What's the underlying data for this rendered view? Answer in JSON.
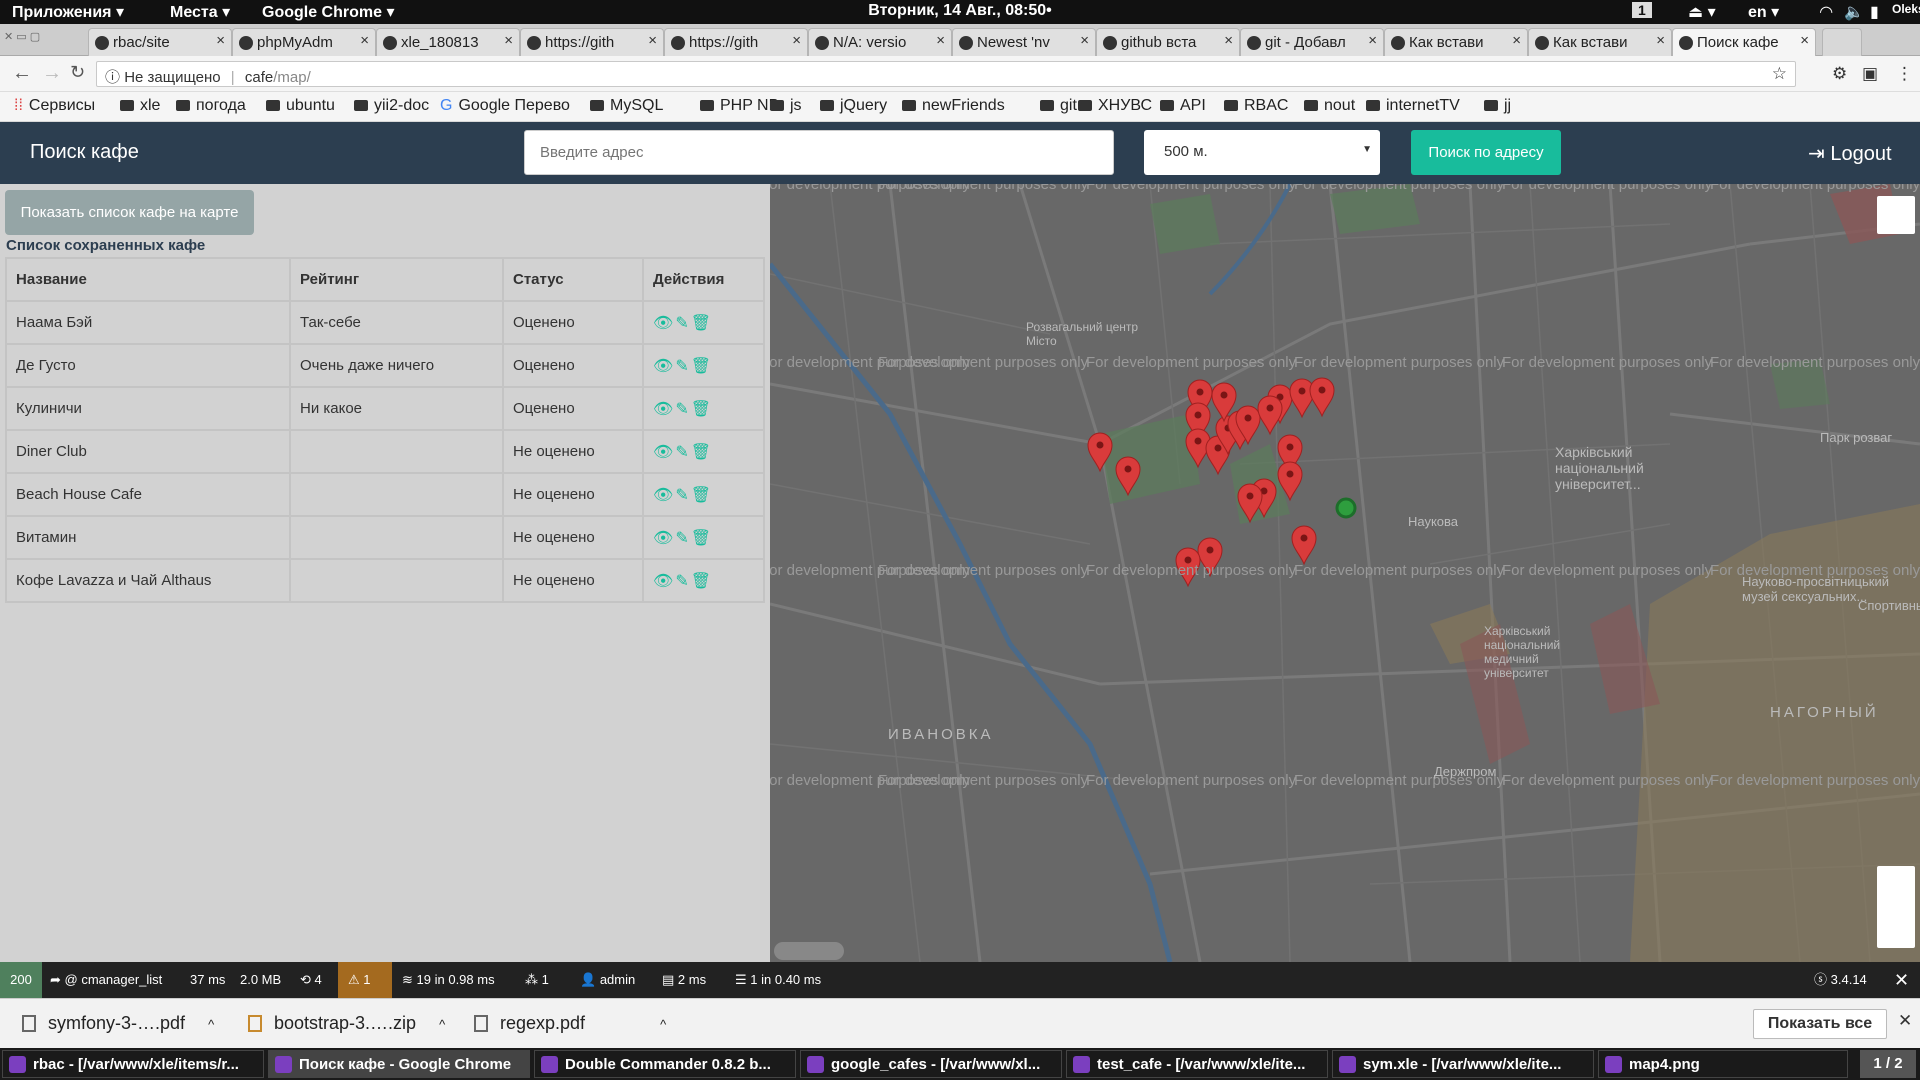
{
  "os": {
    "apps_menu": "Приложения ▾",
    "places_menu": "Места ▾",
    "chrome_menu": "Google Chrome ▾",
    "clock": "Вторник, 14 Авг., 08:50•",
    "workspace": "1",
    "lang": "en ▾",
    "user": "Oleksii"
  },
  "tabs": [
    {
      "label": "rbac/site"
    },
    {
      "label": "phpMyAdm"
    },
    {
      "label": "xle_180813"
    },
    {
      "label": "https://gith"
    },
    {
      "label": "https://gith"
    },
    {
      "label": "N/A: versio"
    },
    {
      "label": "Newest 'nv"
    },
    {
      "label": "github вста"
    },
    {
      "label": "git - Добавл"
    },
    {
      "label": "Как встави"
    },
    {
      "label": "Как встави"
    },
    {
      "label": "Поиск кафе"
    }
  ],
  "address": {
    "security": "Не защищено",
    "url_host": "cafe",
    "url_path": "/map/"
  },
  "bookmarks": [
    "Сервисы",
    "xle",
    "погода",
    "ubuntu",
    "yii2-doc",
    "Google Перево",
    "MySQL",
    "PHP NB",
    "js",
    "jQuery",
    "newFriends",
    "git",
    "ХНУВС",
    "API",
    "RBAC",
    "nout",
    "internetTV",
    "jj"
  ],
  "app": {
    "brand": "Поиск кафе",
    "address_placeholder": "Введите адрес",
    "radius_value": "500 м.",
    "search_button": "Поиск по адресу",
    "logout": "Logout"
  },
  "panel": {
    "show_list_button": "Показать список кафе на карте",
    "list_title": "Список сохраненных кафе",
    "columns": [
      "Название",
      "Рейтинг",
      "Статус",
      "Действия"
    ],
    "rows": [
      {
        "name": "Наама Бэй",
        "rating": "Так-себе",
        "status": "Оценено"
      },
      {
        "name": "Де Густо",
        "rating": "Очень даже ничего",
        "status": "Оценено"
      },
      {
        "name": "Кулиничи",
        "rating": "Ни какое",
        "status": "Оценено"
      },
      {
        "name": "Diner Club",
        "rating": "",
        "status": "Не оценено"
      },
      {
        "name": "Beach House Cafe",
        "rating": "",
        "status": "Не оценено"
      },
      {
        "name": "Витамин",
        "rating": "",
        "status": "Не оценено"
      },
      {
        "name": "Кофе Lavazza и Чай Althaus",
        "rating": "",
        "status": "Не оценено"
      }
    ]
  },
  "map": {
    "watermark": "For development purposes only",
    "labels": {
      "kharkiv_univ": "Харківський національний університет...",
      "park": "Парк розваг",
      "ivanovka": "ИВАНОВКА",
      "nagorny": "НАГОРНЫЙ",
      "derzhprom": "Держпром",
      "museum": "Науково-просвітницький музей сексуальних...",
      "med_univ": "Харківський національний медичний університет",
      "ent_center": "Розвагальний центр Місто",
      "sportivny": "Спортивны",
      "naukova": "Наукова"
    }
  },
  "sfbar": {
    "status": "200",
    "route": "@ cmanager_list",
    "time": "37 ms",
    "memory": "2.0 MB",
    "forms": "4",
    "warnings": "1",
    "twig": "19 in 0.98 ms",
    "translations": "1",
    "user": "admin",
    "cache": "2 ms",
    "db": "1 in 0.40 ms",
    "version": "3.4.14"
  },
  "downloads": {
    "items": [
      "symfony-3-….pdf",
      "bootstrap-3.….zip",
      "regexp.pdf"
    ],
    "show_all": "Показать все"
  },
  "taskbar": {
    "tasks": [
      "rbac - [/var/www/xle/items/r...",
      "Поиск кафе - Google Chrome",
      "Double Commander 0.8.2 b...",
      "google_cafes - [/var/www/xl...",
      "test_cafe - [/var/www/xle/ite...",
      "sym.xle - [/var/www/xle/ite...",
      "map4.png"
    ],
    "pager": "1 / 2"
  }
}
